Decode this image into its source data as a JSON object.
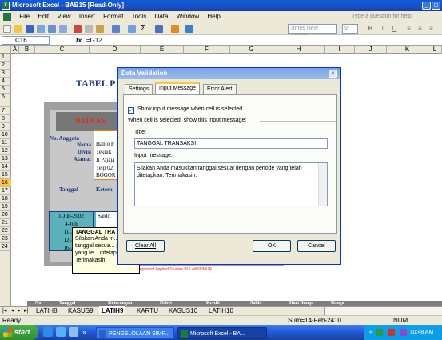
{
  "window": {
    "title": "Microsoft Excel - BAB15  [Read-Only]",
    "app_icon": "excel-icon",
    "controls": [
      "_",
      "◻",
      "×"
    ]
  },
  "menu": {
    "items": [
      "File",
      "Edit",
      "View",
      "Insert",
      "Format",
      "Tools",
      "Data",
      "Window",
      "Help"
    ],
    "help_placeholder": "Type a question for help"
  },
  "toolbar": {
    "font_name": "Times New Roman",
    "font_size": "9",
    "bold": "B",
    "italic": "I",
    "underline": "U"
  },
  "formula_bar": {
    "name_box": "C16",
    "fx": "fx",
    "formula": "=G12"
  },
  "grid": {
    "columns": [
      "A",
      "B",
      "C",
      "D",
      "E",
      "F",
      "G",
      "H",
      "I",
      "J",
      "K",
      "L"
    ],
    "rows": [
      "1",
      "2",
      "3",
      "4",
      "5",
      "6",
      "7",
      "8",
      "9",
      "10",
      "11",
      "12",
      "13",
      "14",
      "15",
      "16",
      "17",
      "18",
      "19",
      "20",
      "21",
      "22",
      "23",
      "24"
    ]
  },
  "sheet": {
    "title": "TABEL P",
    "data_header": "DATA AN",
    "anggota_label": "No. Anggota",
    "fields": [
      {
        "label": "Nama",
        "value": "Hanto P"
      },
      {
        "label": "Divisi",
        "value": "Teknik"
      },
      {
        "label": "Alamat",
        "value": "Jl Pajaja"
      }
    ],
    "extra_values": [
      "Telp 02",
      "BOGOR"
    ],
    "table_headers": [
      "Tanggal",
      "Ketera"
    ],
    "table_rows": [
      {
        "date": "1-Jun-2002",
        "desc": "Saldo"
      },
      {
        "date": "4-Jun",
        "desc": ""
      },
      {
        "date": "11-Jun",
        "desc": ""
      },
      {
        "date": "12-Jun",
        "desc": ""
      },
      {
        "date": "16-Jun",
        "desc": ""
      }
    ],
    "credit": "g & Management Applied Studies BULAKSUMUR",
    "bottom_headers": [
      "No",
      "Tanggal",
      "Keterangan",
      "Debet",
      "Kredit",
      "Saldo",
      "Hari Bunga",
      "Bunga"
    ]
  },
  "tooltip": {
    "title": "TANGGAL TRA",
    "message": "Silakan Anda m... tanggal sesua... periode yang te... ditetapkan. Terimakasih."
  },
  "dialog": {
    "title": "Data Validation",
    "tabs": [
      "Settings",
      "Input Message",
      "Error Alert"
    ],
    "active_tab": "Input Message",
    "checkbox_label": "Show input message when cell is selected",
    "checkbox_checked": true,
    "section_label": "When cell is selected, show this input message:",
    "title_label": "Title:",
    "title_value": "TANGGAL TRANSAKSI",
    "message_label": "Input message:",
    "message_value": "Silakan Anda masukkan tanggal sesuai dengan periode yang telah ditetapkan. Terimakasih.",
    "clear_all": "Clear All",
    "ok": "OK",
    "cancel": "Cancel"
  },
  "sheet_tabs": {
    "tabs": [
      "LATIH8",
      "KASUS9",
      "LATIH9",
      "KARTU",
      "KASUS10",
      "LATIH10"
    ],
    "active": "LATIH9"
  },
  "status": {
    "ready": "Ready",
    "sum": "Sum=14-Feb-2410",
    "num": "NUM"
  },
  "taskbar": {
    "start": "start",
    "buttons": [
      "PENGELOLAAN SIMP...",
      "Microsoft Excel - BA..."
    ],
    "chevron": "»",
    "tray_chevron": "«",
    "clock": "10:48 AM"
  }
}
